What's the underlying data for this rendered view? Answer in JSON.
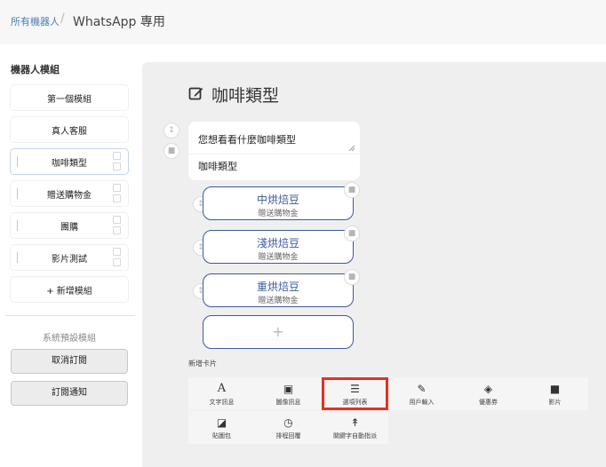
{
  "breadcrumb": {
    "root": "所有機器人",
    "separator": "/",
    "current": "WhatsApp 專用"
  },
  "sidebar": {
    "title": "機器人模組",
    "modules": [
      {
        "label": "第一個模組"
      },
      {
        "label": "真人客服"
      },
      {
        "label": "咖啡類型"
      },
      {
        "label": "贈送購物金"
      },
      {
        "label": "團購"
      },
      {
        "label": "影片測試"
      },
      {
        "label": "+ 新增模組"
      }
    ],
    "system_title": "系統預設模組",
    "system_buttons": [
      {
        "label": "取消訂閱"
      },
      {
        "label": "訂閱通知"
      }
    ]
  },
  "editor": {
    "title": "咖啡類型",
    "card": {
      "question": "您想看看什麼咖啡類型",
      "text": "咖啡類型"
    },
    "options": [
      {
        "title": "中烘焙豆",
        "subtitle": "贈送購物金"
      },
      {
        "title": "淺烘焙豆",
        "subtitle": "贈送購物金"
      },
      {
        "title": "重烘焙豆",
        "subtitle": "贈送購物金"
      }
    ],
    "add_option": "+"
  },
  "new_card": {
    "label": "新增卡片",
    "tools": [
      {
        "icon": "font-icon",
        "glyph": "A",
        "label": "文字訊息"
      },
      {
        "icon": "image-icon",
        "glyph": "▣",
        "label": "圖像訊息"
      },
      {
        "icon": "list-icon",
        "glyph": "☰",
        "label": "選項列表",
        "highlighted": true
      },
      {
        "icon": "edit-icon",
        "glyph": "✎",
        "label": "用戶輸入"
      },
      {
        "icon": "ticket-icon",
        "glyph": "◈",
        "label": "優惠券"
      },
      {
        "icon": "video-icon",
        "glyph": "■",
        "label": "影片"
      },
      {
        "icon": "sticker-icon",
        "glyph": "◪",
        "label": "貼圖包"
      },
      {
        "icon": "clock-icon",
        "glyph": "◷",
        "label": "排程回覆"
      },
      {
        "icon": "keyword-icon",
        "glyph": "↟",
        "label": "關鍵字自動指派"
      }
    ]
  },
  "colors": {
    "accent": "#3b5b9a",
    "highlight": "#e8301d",
    "link": "#4a7fb5"
  }
}
